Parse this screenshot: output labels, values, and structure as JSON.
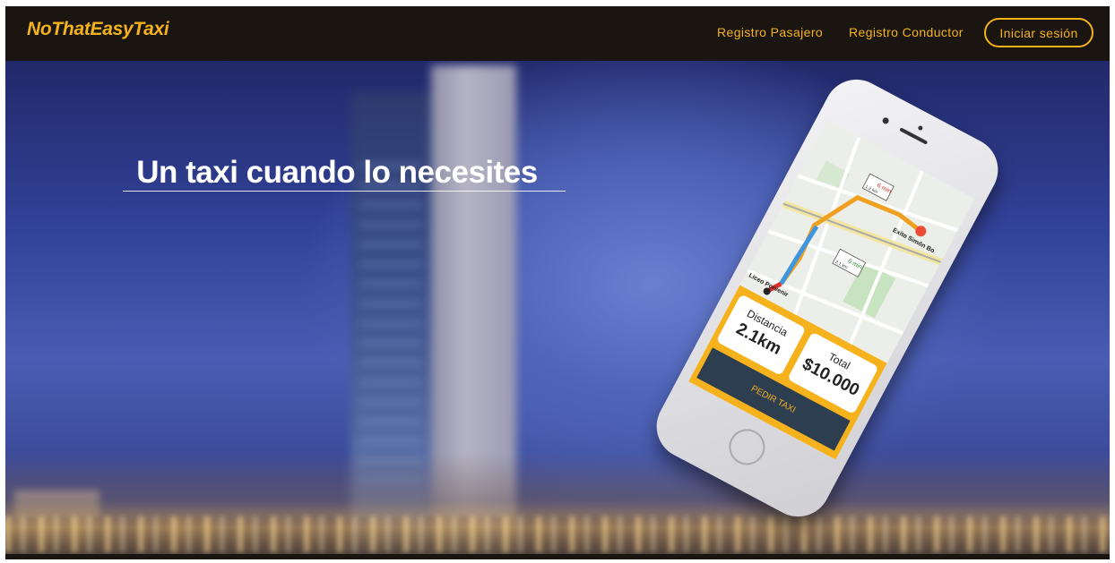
{
  "navbar": {
    "brand": "NoThatEasyTaxi",
    "links": [
      {
        "label": "Registro Pasajero"
      },
      {
        "label": "Registro Conductor"
      }
    ],
    "login_label": "Iniciar sesión"
  },
  "hero": {
    "title": "Un taxi cuando lo necesites"
  },
  "phone": {
    "map_labels": {
      "eta_top": "6 min",
      "dist_top": "1,2 km",
      "eta_mid": "6 min",
      "dist_mid": "2,1 km",
      "destination": "Exito Simón Bo",
      "origin": "Liceo Porvenir"
    },
    "distance_label": "Distancia",
    "distance_value": "2.1km",
    "total_label": "Total",
    "total_value": "$10.000",
    "button_label": "PEDIR TAXI"
  },
  "colors": {
    "accent": "#f4b31a",
    "navbar_bg": "#1a1510",
    "button_dark": "#2d3e50"
  }
}
